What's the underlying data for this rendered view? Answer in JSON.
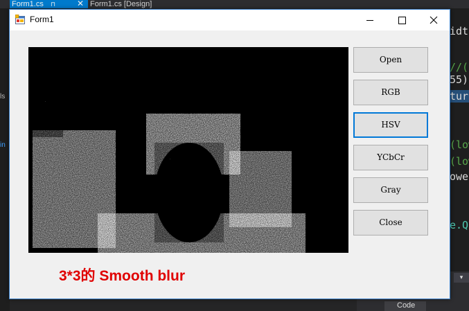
{
  "ide": {
    "tabs": [
      {
        "label": "Form1.cs",
        "pin": "⊓",
        "close": "✕"
      },
      {
        "label": "Form1.cs [Design]"
      }
    ],
    "left_labels": [
      "ls",
      "in"
    ],
    "code_snippets": [
      "idth",
      "//(",
      "55)",
      "ture",
      "(low",
      "(low",
      "owe",
      "e.Q"
    ],
    "bottom_tab_label": "Code",
    "dropdown_glyph": "▾"
  },
  "window": {
    "title": "Form1"
  },
  "buttons": [
    {
      "id": "open",
      "label": "Open",
      "focused": false
    },
    {
      "id": "rgb",
      "label": "RGB",
      "focused": false
    },
    {
      "id": "hsv",
      "label": "HSV",
      "focused": true
    },
    {
      "id": "ycbcr",
      "label": "YCbCr",
      "focused": false
    },
    {
      "id": "gray",
      "label": "Gray",
      "focused": false
    },
    {
      "id": "close",
      "label": "Close",
      "focused": false
    }
  ],
  "caption": "3*3的  Smooth blur",
  "colors": {
    "accent": "#0078d7",
    "ide_tab_active": "#007acc",
    "caption": "#e00000",
    "window_bg": "#f0f0f0"
  },
  "picture": {
    "description_icon": "noisy-binary-webcam-image"
  }
}
